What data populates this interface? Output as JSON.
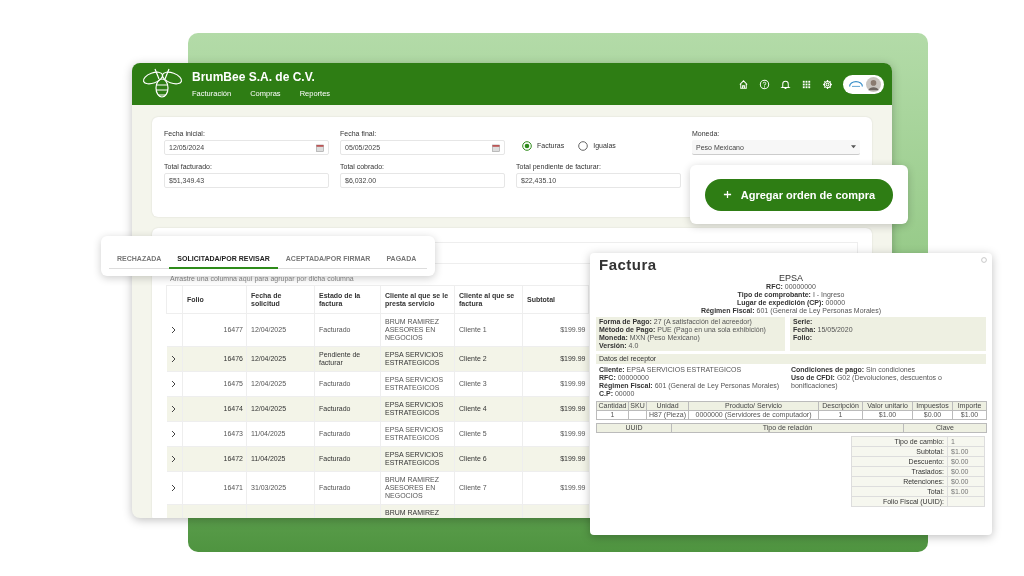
{
  "app": {
    "company": "BrumBee S.A. de C.V.",
    "nav": [
      {
        "label": "Facturación"
      },
      {
        "label": "Compras"
      },
      {
        "label": "Reportes"
      }
    ]
  },
  "filters": {
    "start_date": {
      "label": "Fecha inicial:",
      "value": "12/05/2024"
    },
    "end_date": {
      "label": "Fecha final:",
      "value": "05/05/2025"
    },
    "doc_type": [
      {
        "label": "Facturas",
        "selected": true
      },
      {
        "label": "Igualas",
        "selected": false
      }
    ],
    "currency": {
      "label": "Moneda:",
      "value": "Peso Mexicano"
    },
    "totals": [
      {
        "label": "Total facturado:",
        "value": "$51,349.43"
      },
      {
        "label": "Total cobrado:",
        "value": "$6,032.00"
      },
      {
        "label": "Total pendiente de facturar:",
        "value": "$22,435.10"
      }
    ]
  },
  "add_button": "Agregar orden de compra",
  "tabs": [
    {
      "label": "RECHAZADA",
      "selected": false
    },
    {
      "label": "SOLICITADA/POR REVISAR",
      "selected": true
    },
    {
      "label": "ACEPTADA/POR FIRMAR",
      "selected": false
    },
    {
      "label": "PAGADA",
      "selected": false
    }
  ],
  "table": {
    "group_hint": "Arrastre una columna aquí para agrupar por dicha columna",
    "columns": [
      "Folio",
      "Fecha de solicitud",
      "Estado de la factura",
      "Cliente al que se le presta servicio",
      "Cliente al que se factura",
      "Subtotal"
    ],
    "rows": [
      {
        "folio": "16477",
        "date": "12/04/2025",
        "status": "Facturado",
        "service_client": "BRUM RAMIREZ ASESORES EN NEGOCIOS",
        "billed_client": "Cliente 1",
        "subtotal": "$199.99"
      },
      {
        "folio": "16476",
        "date": "12/04/2025",
        "status": "Pendiente de facturar",
        "service_client": "EPSA SERVICIOS ESTRATEGICOS",
        "billed_client": "Cliente 2",
        "subtotal": "$199.99"
      },
      {
        "folio": "16475",
        "date": "12/04/2025",
        "status": "Facturado",
        "service_client": "EPSA SERVICIOS ESTRATEGICOS",
        "billed_client": "Cliente 3",
        "subtotal": "$199.99"
      },
      {
        "folio": "16474",
        "date": "12/04/2025",
        "status": "Facturado",
        "service_client": "EPSA SERVICIOS ESTRATEGICOS",
        "billed_client": "Cliente 4",
        "subtotal": "$199.99"
      },
      {
        "folio": "16473",
        "date": "11/04/2025",
        "status": "Facturado",
        "service_client": "EPSA SERVICIOS ESTRATEGICOS",
        "billed_client": "Cliente 5",
        "subtotal": "$199.99"
      },
      {
        "folio": "16472",
        "date": "11/04/2025",
        "status": "Facturado",
        "service_client": "EPSA SERVICIOS ESTRATEGICOS",
        "billed_client": "Cliente 6",
        "subtotal": "$199.99"
      },
      {
        "folio": "16471",
        "date": "31/03/2025",
        "status": "Facturado",
        "service_client": "BRUM RAMIREZ ASESORES EN NEGOCIOS",
        "billed_client": "Cliente 7",
        "subtotal": "$199.99"
      },
      {
        "service_client": "BRUM RAMIREZ"
      }
    ]
  },
  "invoice": {
    "title": "Factura",
    "issuer": "EPSA",
    "issuer_details": [
      {
        "label": "RFC:",
        "value": "00000000"
      },
      {
        "label": "Tipo de comprobante:",
        "value": "I - Ingreso"
      },
      {
        "label": "Lugar de expedición (CP):",
        "value": "00000"
      },
      {
        "label": "Régimen Fiscal:",
        "value": "601 (General de Ley Personas Morales)"
      }
    ],
    "payment": [
      {
        "label": "Forma de Pago:",
        "value": "27 (A satisfacción del acreedor)"
      },
      {
        "label": "Método de Pago:",
        "value": "PUE (Pago en una sola exhibición)"
      },
      {
        "label": "Moneda:",
        "value": "MXN (Peso Mexicano)"
      },
      {
        "label": "Versión:",
        "value": "4.0"
      }
    ],
    "document": [
      {
        "label": "Serie:"
      },
      {
        "label": "Fecha:",
        "value": "15/05/2020"
      },
      {
        "label": "Folio:"
      }
    ],
    "receiver_heading": "Datos del receptor",
    "receiver_left": [
      {
        "label": "Cliente:",
        "value": "EPSA SERVICIOS ESTRATEGICOS"
      },
      {
        "label": "RFC:",
        "value": "00000000"
      },
      {
        "label": "Régimen Fiscal:",
        "value": "601 (General de Ley Personas Morales)"
      },
      {
        "label": "C.P:",
        "value": "00000"
      }
    ],
    "receiver_right": [
      {
        "label": "Condiciones de pago:",
        "value": "Sin condiciones"
      },
      {
        "label": "Uso de CFDI:",
        "value": "G02 (Devoluciones, descuentos o bonificaciones)"
      }
    ],
    "items": {
      "columns": [
        "Cantidad",
        "SKU",
        "Unidad",
        "Producto/ Servicio",
        "Descripción",
        "Valor unitario",
        "Impuestos",
        "Importe"
      ],
      "rows": [
        {
          "quantity": "1",
          "unit": "H87 (Pieza)",
          "product": "0000000 (Servidores de computador)",
          "description": "1",
          "unit_value": "$1.00",
          "taxes": "$0.00",
          "amount": "$1.00"
        }
      ]
    },
    "relations": {
      "columns": [
        "UUID",
        "Tipo de relación",
        "Clave"
      ]
    },
    "totals": [
      {
        "label": "Tipo de cambio:",
        "value": "1"
      },
      {
        "label": "Subtotal:",
        "value": "$1.00"
      },
      {
        "label": "Descuento:",
        "value": "$0.00"
      },
      {
        "label": "Traslados:",
        "value": "$0.00"
      },
      {
        "label": "Retenciones:",
        "value": "$0.00"
      },
      {
        "label": "Total:",
        "value": "$1.00"
      },
      {
        "label": "Folio Fiscal (UUID):"
      }
    ]
  }
}
